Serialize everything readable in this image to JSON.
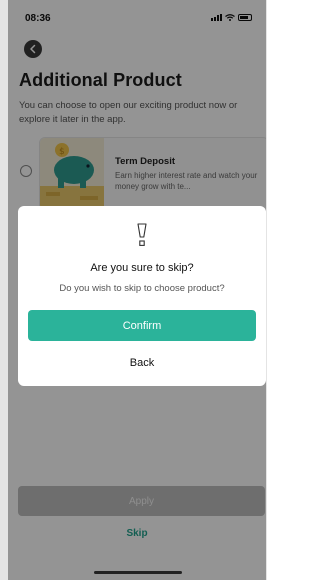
{
  "status_bar": {
    "time": "08:36"
  },
  "header": {
    "back_icon": "arrow-left-icon",
    "title": "Additional Product",
    "description": "You can choose to open our exciting product now or explore it later in the app."
  },
  "product": {
    "title": "Term Deposit",
    "description": "Earn higher interest rate and watch your money grow with te..."
  },
  "footer": {
    "apply_label": "Apply",
    "skip_label": "Skip"
  },
  "dialog": {
    "icon": "exclamation-icon",
    "title": "Are you sure to skip?",
    "subtitle": "Do you wish to skip to choose product?",
    "confirm_label": "Confirm",
    "back_label": "Back"
  },
  "colors": {
    "accent": "#2bb39a",
    "skip_text": "#22a38e",
    "apply_disabled": "#bdbdbd"
  }
}
